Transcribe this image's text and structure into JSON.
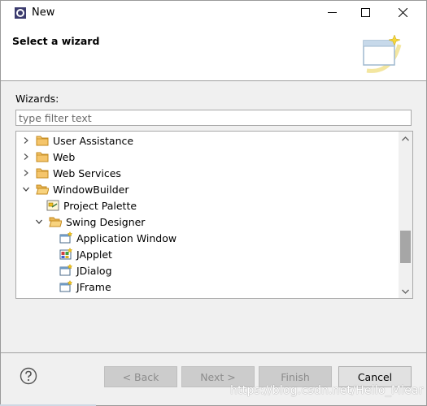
{
  "window": {
    "title": "New",
    "min_icon": "minimize-icon",
    "max_icon": "maximize-icon",
    "close_icon": "close-icon"
  },
  "header": {
    "title": "Select a wizard",
    "graphic": "wizard-banner-icon"
  },
  "filter": {
    "label": "Wizards:",
    "placeholder": "type filter text",
    "value": ""
  },
  "tree": {
    "rows": [
      {
        "label": "User Assistance",
        "icon": "folder-icon",
        "expanded": false
      },
      {
        "label": "Web",
        "icon": "folder-icon",
        "expanded": false
      },
      {
        "label": "Web Services",
        "icon": "folder-icon",
        "expanded": false
      },
      {
        "label": "WindowBuilder",
        "icon": "folder-open-icon",
        "expanded": true
      },
      {
        "label": "Project Palette",
        "icon": "palette-icon"
      },
      {
        "label": "Swing Designer",
        "icon": "folder-open-icon",
        "expanded": true
      },
      {
        "label": "Application Window",
        "icon": "window-new-icon"
      },
      {
        "label": "JApplet",
        "icon": "applet-icon"
      },
      {
        "label": "JDialog",
        "icon": "window-new-icon"
      },
      {
        "label": "JFrame",
        "icon": "window-new-icon"
      }
    ]
  },
  "buttons": {
    "back": "< Back",
    "next": "Next >",
    "finish": "Finish",
    "cancel": "Cancel",
    "help_icon": "help-icon"
  },
  "watermark": "https://blog.csdn.net/Hello_Mlear"
}
